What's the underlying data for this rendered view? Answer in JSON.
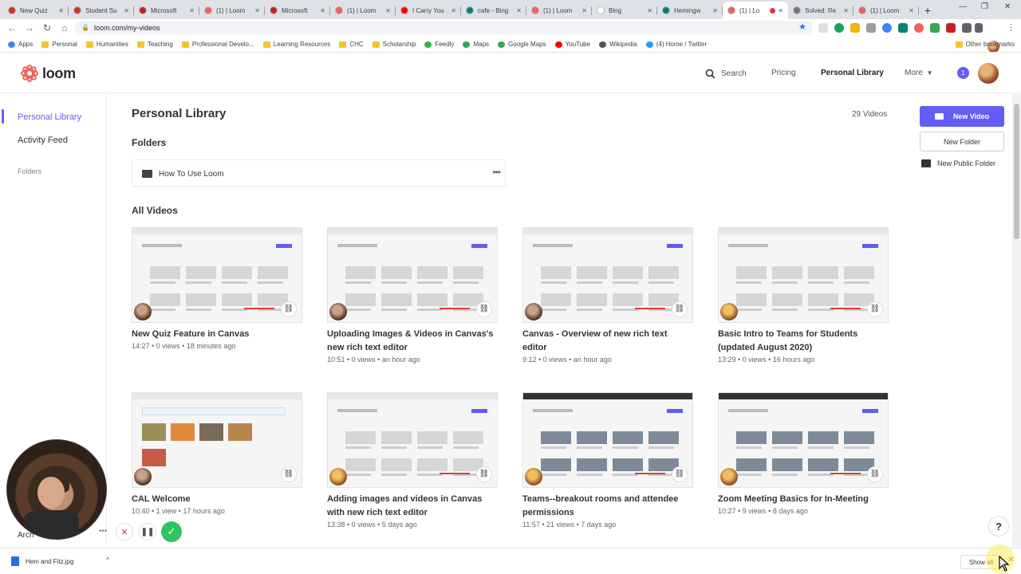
{
  "browser": {
    "tabs": [
      {
        "title": "New Quiz",
        "color": "#d93025"
      },
      {
        "title": "Student Su",
        "color": "#d93025"
      },
      {
        "title": "Microsoft",
        "color": "#c5221f"
      },
      {
        "title": "(1) | Loom",
        "color": "#f0625c"
      },
      {
        "title": "Microsoft",
        "color": "#c5221f"
      },
      {
        "title": "(1) | Loom",
        "color": "#f0625c"
      },
      {
        "title": "I Carry You",
        "color": "#ff0000"
      },
      {
        "title": "cafe - Bing",
        "color": "#008373"
      },
      {
        "title": "(1) | Loom",
        "color": "#f0625c"
      },
      {
        "title": "Bing",
        "color": "#ffffff"
      },
      {
        "title": "Hemingw",
        "color": "#008373"
      },
      {
        "title": "(1) | Lo",
        "color": "#f0625c"
      },
      {
        "title": "Solved: Re",
        "color": "#777777"
      },
      {
        "title": "(1) | Loom",
        "color": "#f0625c"
      }
    ],
    "url": "loom.com/my-videos",
    "bookmarks": [
      {
        "label": "Apps",
        "icon": "apps-grid-icon"
      },
      {
        "label": "Personal",
        "icon": "folder-icon"
      },
      {
        "label": "Humanities",
        "icon": "folder-icon"
      },
      {
        "label": "Teaching",
        "icon": "folder-icon"
      },
      {
        "label": "Professional Develo...",
        "icon": "folder-icon"
      },
      {
        "label": "Learning Resources",
        "icon": "folder-icon"
      },
      {
        "label": "CHC",
        "icon": "folder-icon"
      },
      {
        "label": "Scholarship",
        "icon": "folder-icon"
      },
      {
        "label": "Feedly",
        "icon": "feedly-icon"
      },
      {
        "label": "Maps",
        "icon": "maps-pin-icon"
      },
      {
        "label": "Google Maps",
        "icon": "maps-pin-icon"
      },
      {
        "label": "YouTube",
        "icon": "youtube-icon"
      },
      {
        "label": "Wikipedia",
        "icon": "wikipedia-icon"
      },
      {
        "label": "(4) Home / Twitter",
        "icon": "twitter-icon"
      }
    ],
    "other_bookmarks": "Other bookmarks"
  },
  "header": {
    "logo": "loom",
    "nav_search": "Search",
    "nav_pricing": "Pricing",
    "nav_library": "Personal Library",
    "nav_more": "More",
    "notification_count": "1"
  },
  "sidebar": {
    "items": [
      {
        "label": "Personal Library"
      },
      {
        "label": "Activity Feed"
      }
    ],
    "folders_heading": "Folders",
    "archive_partial": "Arch"
  },
  "main": {
    "title": "Personal Library",
    "video_count": "29 Videos",
    "folders_heading": "Folders",
    "folders": [
      {
        "name": "How To Use Loom"
      }
    ],
    "all_videos_heading": "All Videos",
    "videos": [
      {
        "title": "New Quiz Feature in Canvas",
        "meta": "14:27 • 0 views • 18 minutes ago",
        "style": "light"
      },
      {
        "title": "Uploading Images & Videos in Canvas's new rich text editor",
        "meta": "10:51 • 0 views • an hour ago",
        "style": "light"
      },
      {
        "title": "Canvas - Overview of new rich text editor",
        "meta": "9:12 • 0 views • an hour ago",
        "style": "light"
      },
      {
        "title": "Basic Intro to Teams for Students (updated August 2020)",
        "meta": "13:29 • 0 views • 16 hours ago",
        "style": "light"
      },
      {
        "title": "CAL Welcome",
        "meta": "10:40 • 1 view • 17 hours ago",
        "style": "canvas"
      },
      {
        "title": "Adding images and videos in Canvas with new rich text editor",
        "meta": "13:38 • 0 views • 5 days ago",
        "style": "light"
      },
      {
        "title": "Teams--breakout rooms and attendee permissions",
        "meta": "11:57 • 21 views • 7 days ago",
        "style": "dark"
      },
      {
        "title": "Zoom Meeting Basics for In-Meeting",
        "meta": "10:27 • 9 views • 8 days ago",
        "style": "dark"
      }
    ]
  },
  "actions": {
    "new_video": "New Video",
    "new_folder": "New Folder",
    "new_public_folder": "New Public Folder"
  },
  "help_label": "?",
  "downloads": {
    "file": "Hem and Fitz.jpg",
    "show_all": "Show all"
  },
  "colors": {
    "accent": "#625df5",
    "recording_red": "#e53935",
    "confirm_green": "#2ec561"
  }
}
